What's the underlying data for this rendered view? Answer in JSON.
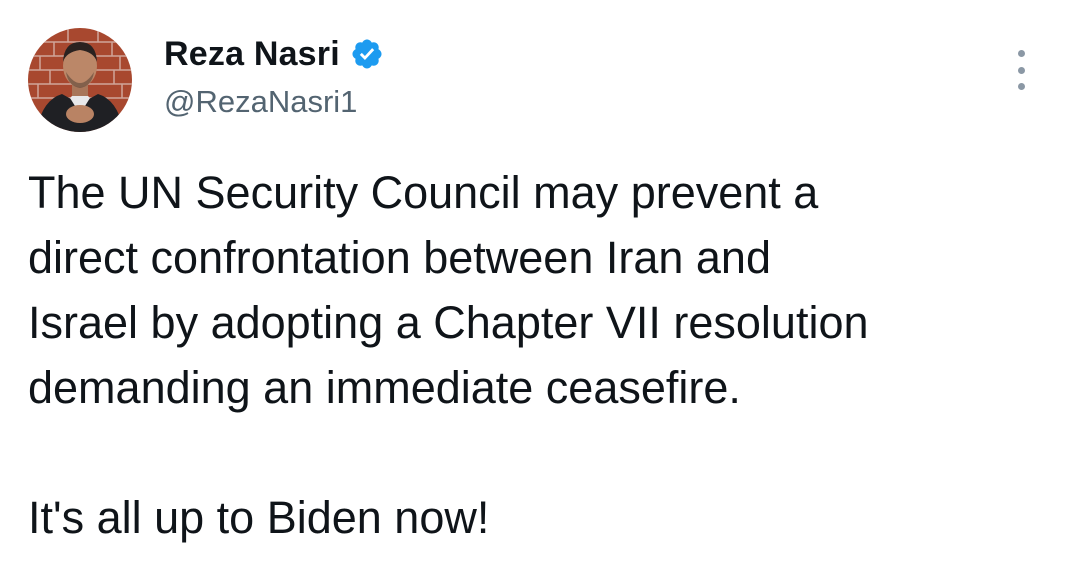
{
  "author": {
    "name": "Reza Nasri",
    "handle": "@RezaNasri1",
    "verified": true,
    "verified_color": "#1d9bf0"
  },
  "icons": {
    "verified": "verified-badge-icon",
    "more": "more-options-icon"
  },
  "tweet": {
    "paragraph_1": "The UN Security Council may prevent a\ndirect confrontation between Iran and\nIsrael by adopting a Chapter VII resolution\ndemanding an immediate ceasefire.",
    "paragraph_2": "It's all up to Biden now!"
  }
}
